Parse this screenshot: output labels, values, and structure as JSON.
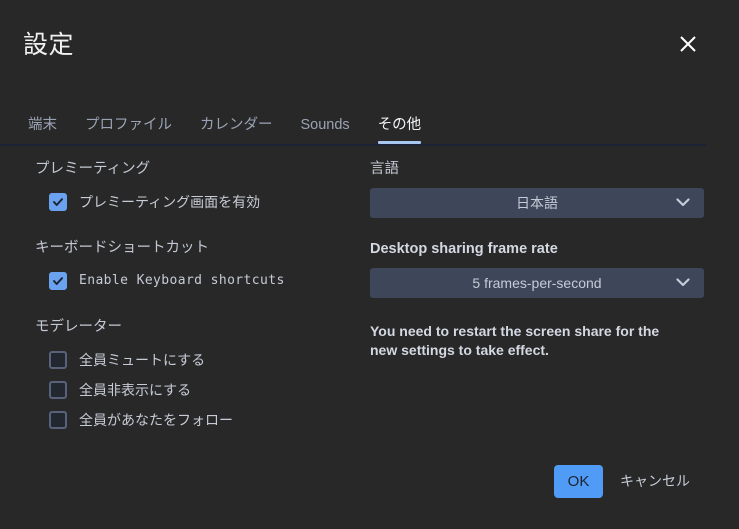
{
  "dialog": {
    "title": "設定",
    "close_icon": "close-icon"
  },
  "tabs": [
    {
      "label": "端末",
      "active": false
    },
    {
      "label": "プロファイル",
      "active": false
    },
    {
      "label": "カレンダー",
      "active": false
    },
    {
      "label": "Sounds",
      "active": false
    },
    {
      "label": "その他",
      "active": true
    }
  ],
  "left_column": {
    "premeeting": {
      "heading": "プレミーティング",
      "checkbox": {
        "label": "プレミーティング画面を有効",
        "checked": true
      }
    },
    "keyboard": {
      "heading": "キーボードショートカット",
      "checkbox": {
        "label": "Enable Keyboard shortcuts",
        "checked": true
      }
    },
    "moderator": {
      "heading": "モデレーター",
      "checkboxes": [
        {
          "label": "全員ミュートにする",
          "checked": false
        },
        {
          "label": "全員非表示にする",
          "checked": false
        },
        {
          "label": "全員があなたをフォロー",
          "checked": false
        }
      ]
    }
  },
  "right_column": {
    "language": {
      "label": "言語",
      "value": "日本語",
      "chevron_icon": "chevron-down-icon"
    },
    "frame_rate": {
      "label": "Desktop sharing frame rate",
      "value": "5 frames-per-second",
      "chevron_icon": "chevron-down-icon"
    },
    "restart_note": "You need to restart the screen share for the new settings to take effect."
  },
  "footer": {
    "ok_label": "OK",
    "cancel_label": "キャンセル"
  },
  "colors": {
    "background": "#282828",
    "accent_blue": "#6aa2f0",
    "ok_button": "#4f9bf5",
    "dropdown_bg": "#3e4759",
    "tab_active_underline": "#a8c7f0",
    "separator": "#1b2233"
  }
}
